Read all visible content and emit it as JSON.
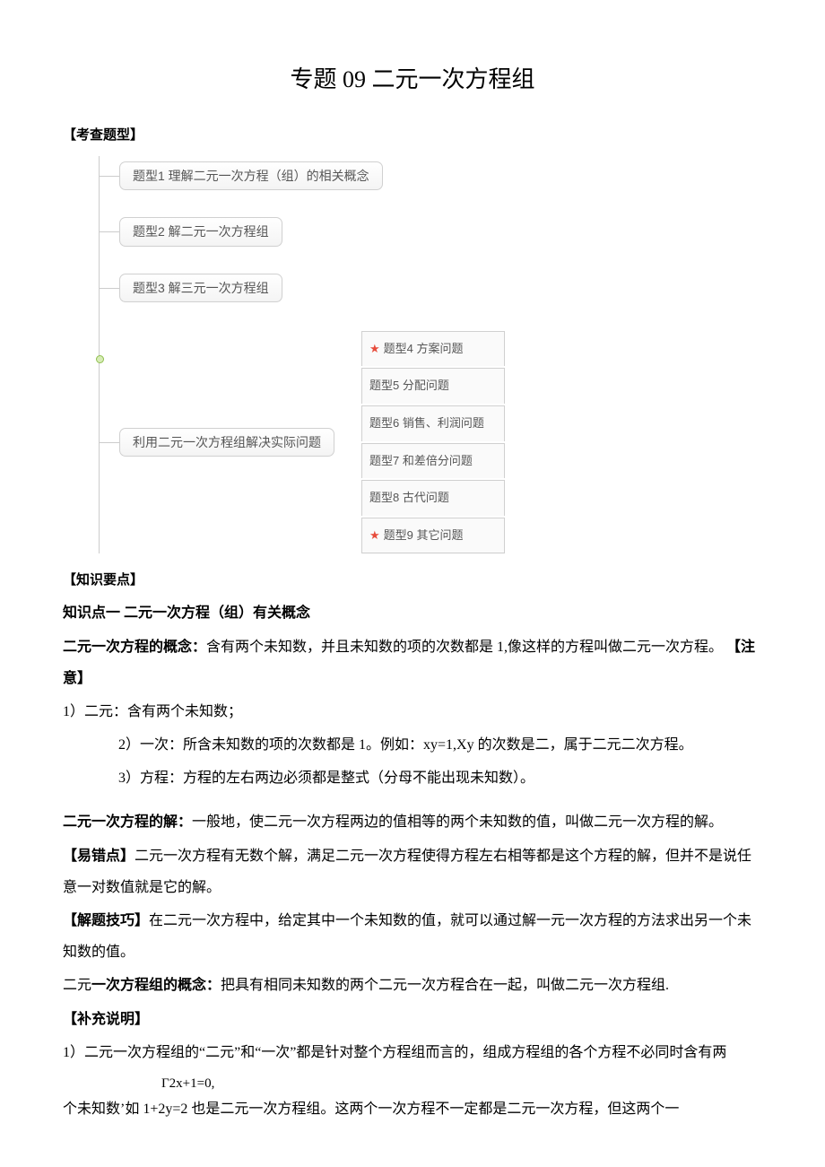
{
  "title": "专题 09 二元一次方程组",
  "sections": {
    "exam_type_label": "【考查题型】",
    "knowledge_label": "【知识要点】"
  },
  "diagram": {
    "n1": "题型1 理解二元一次方程（组）的相关概念",
    "n2": "题型2 解二元一次方程组",
    "n3": "题型3 解三元一次方程组",
    "n4": "利用二元一次方程组解决实际问题",
    "sub": {
      "s4": "题型4 方案问题",
      "s5": "题型5 分配问题",
      "s6": "题型6 销售、利润问题",
      "s7": "题型7 和差倍分问题",
      "s8": "题型8 古代问题",
      "s9": "题型9 其它问题"
    }
  },
  "kp1_heading": "知识点一 二元一次方程（组）有关概念",
  "def1_label": "二元一次方程的概念：",
  "def1_text": "含有两个未知数，并且未知数的项的次数都是 1,像这样的方程叫做二元一次方程。",
  "note_label": "【注意】",
  "note1": "1）二元：含有两个未知数；",
  "note2": "2）一次：所含未知数的项的次数都是 1。例如：xy=1,Xy 的次数是二，属于二元二次方程。",
  "note3": "3）方程：方程的左右两边必须都是整式（分母不能出现未知数）。",
  "sol_label": "二元一次方程的解：",
  "sol_text": "一般地，使二元一次方程两边的值相等的两个未知数的值，叫做二元一次方程的解。",
  "err_label": "【易错点】",
  "err_text": "二元一次方程有无数个解，满足二元一次方程使得方程左右相等都是这个方程的解，但并不是说任意一对数值就是它的解。",
  "skill_label": "【解题技巧】",
  "skill_text": "在二元一次方程中，给定其中一个未知数的值，就可以通过解一元一次方程的方法求出另一个未知数的值。",
  "group_label_prefix": "二元",
  "group_label_rest": "一次方程组的概念：",
  "group_text": "把具有相同未知数的两个二元一次方程合在一起，叫做二元一次方程组.",
  "supp_label": "【补充说明】",
  "supp1": "1）二元一次方程组的“二元”和“一次”都是针对整个方程组而言的，组成方程组的各个方程不必同时含有两",
  "supp2_a": "个未知数’如 1+2y=2 也是二元一次方程组。这两个一次方程不一定都是二元一次方程，但这两个一",
  "supp2_inline": "Γ2x+1=0,"
}
